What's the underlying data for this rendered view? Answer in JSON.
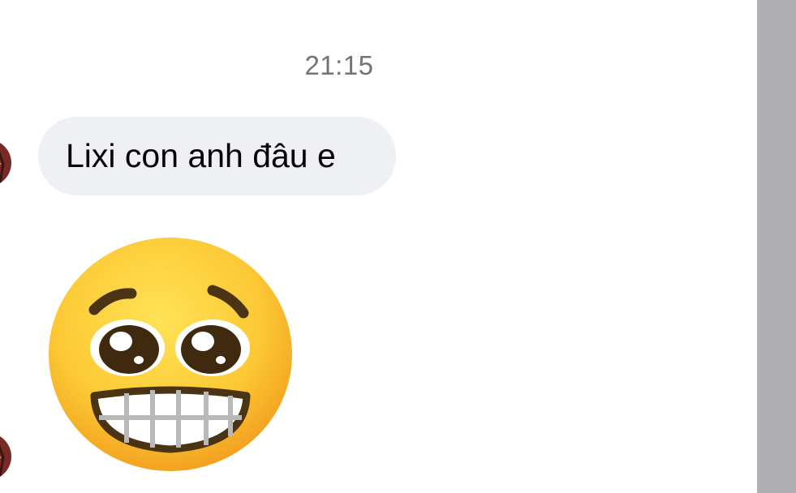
{
  "chat": {
    "timestamp": "21:15",
    "messages": [
      {
        "type": "text",
        "text": "Lixi con anh đâu e"
      },
      {
        "type": "emoji",
        "emoji": "grimacing-teary-face"
      }
    ]
  },
  "colors": {
    "bubble_bg": "#eff0f3",
    "timestamp": "#737373",
    "side_strip": "#b0afb3"
  }
}
